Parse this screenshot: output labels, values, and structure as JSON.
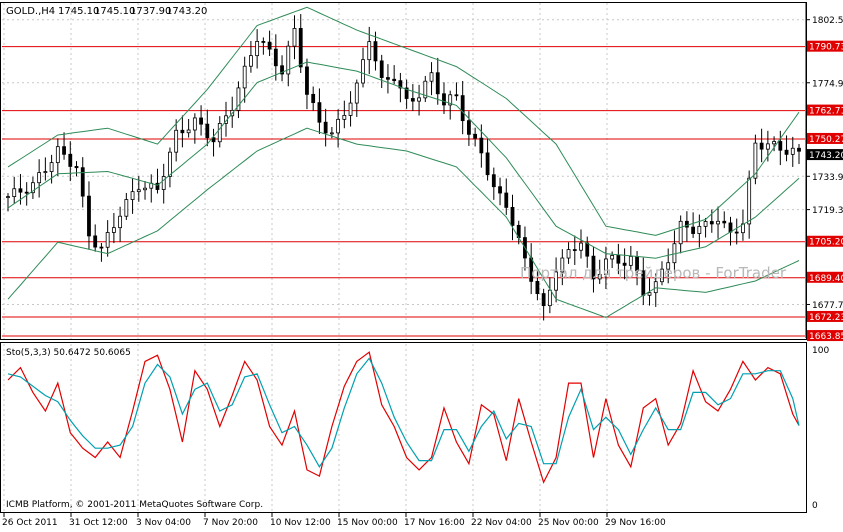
{
  "header": {
    "symbol": "GOLD.,H4",
    "open": "1745.10",
    "high": "1745.10",
    "low": "1737.90",
    "close": "1743.20"
  },
  "watermark": "Портал для трейдеров - ForTrader",
  "colors": {
    "candle": "#000000",
    "bollinger": "#2e8b57",
    "hline": "#e00000",
    "stoch_main": "#e00000",
    "stoch_signal": "#00a0b0",
    "grid": "#c8c8c8"
  },
  "chart_data": [
    {
      "type": "candlestick",
      "title": "GOLD.,H4",
      "ylim": [
        1663,
        1809
      ],
      "price_ticks": [
        "1802.55",
        "1774.90",
        "1733.90",
        "1719.30",
        "1677.70"
      ],
      "horizontal_lines": [
        {
          "label": "1790.73",
          "value": 1790.73
        },
        {
          "label": "1762.71",
          "value": 1762.71
        },
        {
          "label": "1750.27",
          "value": 1750.27
        },
        {
          "label": "1705.20",
          "value": 1705.2
        },
        {
          "label": "1689.40",
          "value": 1689.4
        },
        {
          "label": "1672.23",
          "value": 1672.23
        },
        {
          "label": "1663.85",
          "value": 1663.85
        }
      ],
      "current_price": {
        "label": "1743.20",
        "value": 1743.2
      },
      "x_labels": [
        "26 Oct 2011",
        "31 Oct 12:00",
        "3 Nov 04:00",
        "7 Nov 20:00",
        "10 Nov 12:00",
        "15 Nov 00:00",
        "17 Nov 16:00",
        "22 Nov 04:00",
        "25 Nov 00:00",
        "29 Nov 16:00"
      ],
      "close_path": [
        [
          0,
          1725
        ],
        [
          4,
          1730
        ],
        [
          8,
          1745
        ],
        [
          11,
          1738
        ],
        [
          13,
          1708
        ],
        [
          15,
          1702
        ],
        [
          18,
          1718
        ],
        [
          21,
          1730
        ],
        [
          24,
          1728
        ],
        [
          27,
          1752
        ],
        [
          30,
          1758
        ],
        [
          33,
          1750
        ],
        [
          36,
          1765
        ],
        [
          38,
          1780
        ],
        [
          40,
          1795
        ],
        [
          42,
          1788
        ],
        [
          44,
          1780
        ],
        [
          46,
          1798
        ],
        [
          48,
          1770
        ],
        [
          50,
          1758
        ],
        [
          52,
          1752
        ],
        [
          54,
          1762
        ],
        [
          56,
          1773
        ],
        [
          58,
          1795
        ],
        [
          60,
          1775
        ],
        [
          62,
          1778
        ],
        [
          64,
          1766
        ],
        [
          66,
          1770
        ],
        [
          68,
          1778
        ],
        [
          70,
          1766
        ],
        [
          72,
          1769
        ],
        [
          74,
          1752
        ],
        [
          76,
          1745
        ],
        [
          78,
          1728
        ],
        [
          80,
          1722
        ],
        [
          82,
          1705
        ],
        [
          84,
          1690
        ],
        [
          86,
          1675
        ],
        [
          88,
          1694
        ],
        [
          90,
          1700
        ],
        [
          92,
          1706
        ],
        [
          94,
          1688
        ],
        [
          96,
          1698
        ],
        [
          98,
          1696
        ],
        [
          100,
          1698
        ],
        [
          102,
          1683
        ],
        [
          104,
          1686
        ],
        [
          106,
          1698
        ],
        [
          108,
          1712
        ],
        [
          110,
          1711
        ],
        [
          112,
          1712
        ],
        [
          114,
          1716
        ],
        [
          116,
          1708
        ],
        [
          118,
          1714
        ],
        [
          120,
          1748
        ],
        [
          122,
          1748
        ],
        [
          124,
          1746
        ],
        [
          126,
          1745
        ],
        [
          127,
          1743.2
        ]
      ],
      "bollinger_upper": [
        [
          0,
          1738
        ],
        [
          8,
          1752
        ],
        [
          16,
          1755
        ],
        [
          24,
          1748
        ],
        [
          32,
          1772
        ],
        [
          40,
          1800
        ],
        [
          48,
          1808
        ],
        [
          56,
          1798
        ],
        [
          64,
          1790
        ],
        [
          72,
          1782
        ],
        [
          80,
          1768
        ],
        [
          88,
          1748
        ],
        [
          96,
          1712
        ],
        [
          104,
          1708
        ],
        [
          112,
          1715
        ],
        [
          120,
          1735
        ],
        [
          127,
          1762
        ]
      ],
      "bollinger_middle": [
        [
          0,
          1720
        ],
        [
          8,
          1735
        ],
        [
          16,
          1736
        ],
        [
          24,
          1730
        ],
        [
          32,
          1748
        ],
        [
          40,
          1775
        ],
        [
          48,
          1784
        ],
        [
          56,
          1780
        ],
        [
          64,
          1772
        ],
        [
          72,
          1765
        ],
        [
          80,
          1742
        ],
        [
          88,
          1712
        ],
        [
          96,
          1700
        ],
        [
          104,
          1698
        ],
        [
          112,
          1703
        ],
        [
          120,
          1716
        ],
        [
          127,
          1733
        ]
      ],
      "bollinger_lower": [
        [
          0,
          1680
        ],
        [
          8,
          1705
        ],
        [
          16,
          1700
        ],
        [
          24,
          1710
        ],
        [
          32,
          1728
        ],
        [
          40,
          1745
        ],
        [
          48,
          1755
        ],
        [
          56,
          1748
        ],
        [
          64,
          1745
        ],
        [
          72,
          1738
        ],
        [
          80,
          1716
        ],
        [
          88,
          1680
        ],
        [
          96,
          1672
        ],
        [
          104,
          1685
        ],
        [
          112,
          1683
        ],
        [
          120,
          1688
        ],
        [
          127,
          1697
        ]
      ]
    },
    {
      "type": "line",
      "title": "Sto(5,3,3)",
      "label": "Sto(5,3,3) 50.6472 50.6065",
      "main_value": "50.6472",
      "signal_value": "50.6065",
      "ylim": [
        0,
        100
      ],
      "y_ticks": [
        "100",
        "0"
      ],
      "series": [
        {
          "name": "main",
          "points": [
            [
              0,
              80
            ],
            [
              2,
              88
            ],
            [
              4,
              72
            ],
            [
              6,
              60
            ],
            [
              8,
              78
            ],
            [
              10,
              46
            ],
            [
              12,
              36
            ],
            [
              14,
              30
            ],
            [
              16,
              40
            ],
            [
              18,
              30
            ],
            [
              20,
              60
            ],
            [
              22,
              92
            ],
            [
              24,
              96
            ],
            [
              26,
              74
            ],
            [
              28,
              40
            ],
            [
              30,
              86
            ],
            [
              32,
              74
            ],
            [
              34,
              50
            ],
            [
              36,
              70
            ],
            [
              38,
              92
            ],
            [
              40,
              80
            ],
            [
              42,
              50
            ],
            [
              44,
              38
            ],
            [
              46,
              60
            ],
            [
              48,
              22
            ],
            [
              50,
              18
            ],
            [
              52,
              50
            ],
            [
              54,
              76
            ],
            [
              56,
              92
            ],
            [
              58,
              98
            ],
            [
              60,
              64
            ],
            [
              62,
              50
            ],
            [
              64,
              30
            ],
            [
              66,
              22
            ],
            [
              68,
              30
            ],
            [
              70,
              62
            ],
            [
              72,
              40
            ],
            [
              74,
              26
            ],
            [
              76,
              64
            ],
            [
              78,
              58
            ],
            [
              80,
              28
            ],
            [
              82,
              68
            ],
            [
              84,
              40
            ],
            [
              86,
              14
            ],
            [
              88,
              30
            ],
            [
              90,
              78
            ],
            [
              92,
              78
            ],
            [
              94,
              30
            ],
            [
              96,
              68
            ],
            [
              98,
              38
            ],
            [
              100,
              24
            ],
            [
              102,
              62
            ],
            [
              104,
              68
            ],
            [
              106,
              38
            ],
            [
              108,
              52
            ],
            [
              110,
              86
            ],
            [
              112,
              66
            ],
            [
              114,
              60
            ],
            [
              116,
              74
            ],
            [
              118,
              92
            ],
            [
              120,
              80
            ],
            [
              122,
              88
            ],
            [
              124,
              84
            ],
            [
              126,
              58
            ],
            [
              127,
              50.6472
            ]
          ]
        },
        {
          "name": "signal",
          "points": [
            [
              0,
              84
            ],
            [
              2,
              82
            ],
            [
              4,
              76
            ],
            [
              6,
              70
            ],
            [
              8,
              66
            ],
            [
              10,
              54
            ],
            [
              12,
              44
            ],
            [
              14,
              36
            ],
            [
              16,
              36
            ],
            [
              18,
              38
            ],
            [
              20,
              50
            ],
            [
              22,
              78
            ],
            [
              24,
              90
            ],
            [
              26,
              82
            ],
            [
              28,
              58
            ],
            [
              30,
              74
            ],
            [
              32,
              78
            ],
            [
              34,
              60
            ],
            [
              36,
              64
            ],
            [
              38,
              82
            ],
            [
              40,
              84
            ],
            [
              42,
              64
            ],
            [
              44,
              46
            ],
            [
              46,
              50
            ],
            [
              48,
              38
            ],
            [
              50,
              24
            ],
            [
              52,
              36
            ],
            [
              54,
              62
            ],
            [
              56,
              84
            ],
            [
              58,
              94
            ],
            [
              60,
              78
            ],
            [
              62,
              56
            ],
            [
              64,
              40
            ],
            [
              66,
              28
            ],
            [
              68,
              28
            ],
            [
              70,
              48
            ],
            [
              72,
              48
            ],
            [
              74,
              34
            ],
            [
              76,
              50
            ],
            [
              78,
              60
            ],
            [
              80,
              42
            ],
            [
              82,
              52
            ],
            [
              84,
              50
            ],
            [
              86,
              26
            ],
            [
              88,
              26
            ],
            [
              90,
              56
            ],
            [
              92,
              74
            ],
            [
              94,
              48
            ],
            [
              96,
              56
            ],
            [
              98,
              48
            ],
            [
              100,
              32
            ],
            [
              102,
              48
            ],
            [
              104,
              62
            ],
            [
              106,
              48
            ],
            [
              108,
              48
            ],
            [
              110,
              72
            ],
            [
              112,
              72
            ],
            [
              114,
              64
            ],
            [
              116,
              68
            ],
            [
              118,
              84
            ],
            [
              120,
              84
            ],
            [
              122,
              86
            ],
            [
              124,
              86
            ],
            [
              126,
              68
            ],
            [
              127,
              50.6065
            ]
          ]
        }
      ]
    }
  ],
  "copyright": "ICMB Platform, © 2001-2011 MetaQuotes Software Corp."
}
